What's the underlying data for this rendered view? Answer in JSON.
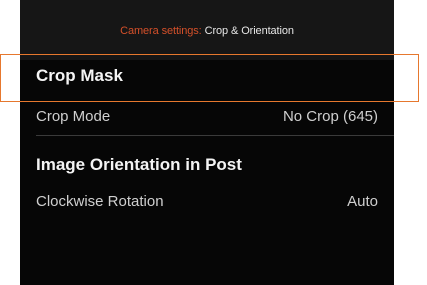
{
  "header": {
    "prefix": "Camera settings:",
    "title": " Crop & Orientation"
  },
  "sections": {
    "crop_mask": {
      "title": "Crop Mask",
      "rows": [
        {
          "label": "Crop Mode",
          "value": "No Crop (645)"
        }
      ]
    },
    "orientation": {
      "title": "Image Orientation in Post",
      "rows": [
        {
          "label": "Clockwise Rotation",
          "value": "Auto"
        }
      ]
    }
  },
  "colors": {
    "accent": "#e6782e",
    "header_prefix": "#d4502a",
    "background": "#060606"
  }
}
